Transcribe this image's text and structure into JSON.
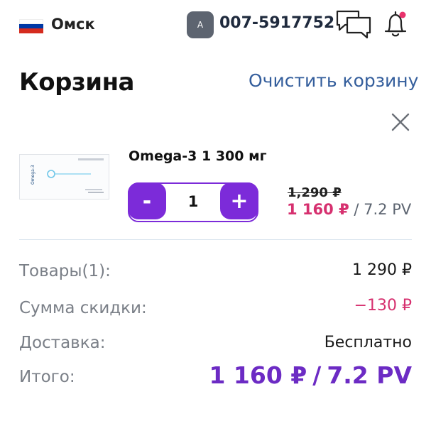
{
  "header": {
    "flag": {
      "colors": [
        "#ffffff",
        "#0039a6",
        "#d52b1e"
      ]
    },
    "city": "Омск",
    "avatar_letter": "А",
    "user_id": "007-5917752",
    "icons": [
      "chat-icon",
      "bell-icon"
    ],
    "notification_dot_color": "#e8326c"
  },
  "cart": {
    "title": "Корзина",
    "clear_label": "Очистить корзину",
    "item": {
      "name": "Omega-3 1 300 мг",
      "quantity": "1",
      "minus_label": "-",
      "plus_label": "+",
      "old_price": "1,290 ₽",
      "new_price": "1 160 ₽",
      "pv": "/ 7.2 PV",
      "package_text": "Omega-3"
    }
  },
  "summary": {
    "goods_label": "Товары(1):",
    "goods_value": "1 290 ₽",
    "discount_label": "Сумма скидки:",
    "discount_value": "−130 ₽",
    "delivery_label": "Доставка:",
    "delivery_value": "Бесплатно",
    "total_label": "Итого:",
    "total_price": "1 160 ₽",
    "total_sep": "/",
    "total_pv": "7.2 PV"
  },
  "colors": {
    "accent": "#7c2bd9",
    "total": "#6c2bc4",
    "price": "#d6306f",
    "link": "#345e9c"
  }
}
